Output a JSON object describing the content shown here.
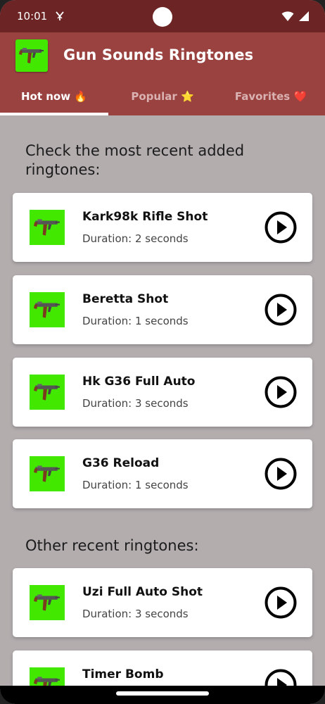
{
  "status": {
    "time": "10:01",
    "network_icon": "data-saver-icon",
    "wifi_icon": "wifi-icon",
    "signal_icon": "cell-signal-icon"
  },
  "app": {
    "title": "Gun Sounds Ringtones",
    "logo_icon": "rifle-icon"
  },
  "tabs": [
    {
      "label": "Hot now 🔥",
      "active": true
    },
    {
      "label": "Popular ⭐",
      "active": false
    },
    {
      "label": "Favorites ❤️",
      "active": false
    }
  ],
  "sections": {
    "recent_title": "Check the most recent added ringtones:",
    "other_title": "Other recent ringtones:"
  },
  "recent_ringtones": [
    {
      "title": "Kark98k Rifle Shot",
      "duration": "Duration: 2 seconds"
    },
    {
      "title": "Beretta Shot",
      "duration": "Duration: 1 seconds"
    },
    {
      "title": "Hk G36 Full Auto",
      "duration": "Duration: 3 seconds"
    },
    {
      "title": "G36 Reload",
      "duration": "Duration: 1 seconds"
    }
  ],
  "other_ringtones": [
    {
      "title": "Uzi Full Auto Shot",
      "duration": "Duration: 3 seconds"
    },
    {
      "title": "Timer Bomb",
      "duration": ""
    }
  ],
  "colors": {
    "status_bar": "#6c2424",
    "app_bar": "#994240",
    "background": "#b3adae",
    "thumb_green": "#43e800"
  }
}
